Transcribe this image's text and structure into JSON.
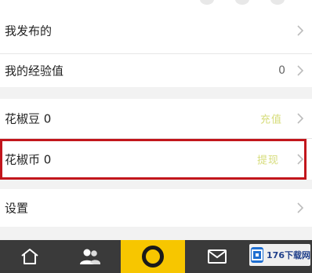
{
  "menu": {
    "items": [
      {
        "label": "我发布的",
        "value": "",
        "action": ""
      },
      {
        "label": "我的经验值",
        "value": "0",
        "action": ""
      },
      {
        "label": "花椒豆 0",
        "value": "",
        "action": "充值"
      },
      {
        "label": "花椒币 0",
        "value": "",
        "action": "提现"
      },
      {
        "label": "设置",
        "value": "",
        "action": ""
      }
    ]
  },
  "highlight": {
    "color": "#c2161c",
    "target": "花椒币 0"
  },
  "tabbar": {
    "tabs": [
      {
        "icon": "home-icon"
      },
      {
        "icon": "friends-icon"
      },
      {
        "icon": "live-camera-icon",
        "active": true
      },
      {
        "icon": "message-icon"
      }
    ],
    "accent_color": "#f7c600"
  },
  "watermark": {
    "text": "176下载网"
  }
}
